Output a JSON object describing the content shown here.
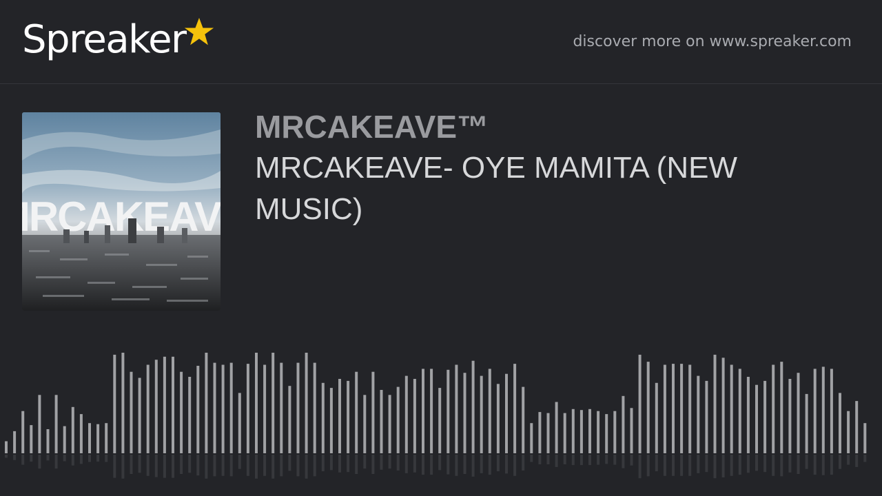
{
  "header": {
    "logo_text": "Spreaker",
    "discover_link": "discover more on www.spreaker.com"
  },
  "episode": {
    "cover_overlay_text": "MRCAKEAVE",
    "channel_name": "MRCAKEAVE™",
    "title": "MRCAKEAVE- OYE MAMITA (NEW MUSIC)"
  },
  "waveform": {
    "bar_color": "#a1a2a5",
    "levels": [
      0.12,
      0.22,
      0.42,
      0.28,
      0.58,
      0.24,
      0.58,
      0.27,
      0.46,
      0.39,
      0.3,
      0.29,
      0.3,
      0.98,
      1.0,
      0.81,
      0.75,
      0.88,
      0.93,
      0.96,
      0.96,
      0.81,
      0.76,
      0.87,
      1.0,
      0.9,
      0.88,
      0.9,
      0.6,
      0.89,
      1.0,
      0.88,
      1.0,
      0.9,
      0.67,
      0.9,
      1.0,
      0.9,
      0.7,
      0.65,
      0.74,
      0.72,
      0.81,
      0.58,
      0.81,
      0.63,
      0.58,
      0.66,
      0.77,
      0.74,
      0.84,
      0.84,
      0.65,
      0.83,
      0.88,
      0.8,
      0.92,
      0.77,
      0.84,
      0.69,
      0.79,
      0.89,
      0.66,
      0.3,
      0.41,
      0.4,
      0.51,
      0.4,
      0.44,
      0.43,
      0.44,
      0.42,
      0.39,
      0.42,
      0.57,
      0.45,
      0.98,
      0.91,
      0.7,
      0.88,
      0.89,
      0.89,
      0.88,
      0.77,
      0.72,
      0.98,
      0.95,
      0.88,
      0.84,
      0.76,
      0.68,
      0.72,
      0.88,
      0.91,
      0.74,
      0.8,
      0.59,
      0.84,
      0.86,
      0.84,
      0.6,
      0.42,
      0.52,
      0.3
    ],
    "reflection_levels": [
      0.08,
      0.14,
      0.26,
      0.18,
      0.36,
      0.15,
      0.36,
      0.17,
      0.28,
      0.24,
      0.19,
      0.18,
      0.19,
      0.6,
      0.62,
      0.5,
      0.47,
      0.55,
      0.58,
      0.6,
      0.6,
      0.5,
      0.47,
      0.54,
      0.62,
      0.56,
      0.55,
      0.56,
      0.37,
      0.55,
      0.62,
      0.55,
      0.62,
      0.56,
      0.42,
      0.56,
      0.62,
      0.56,
      0.43,
      0.4,
      0.46,
      0.45,
      0.5,
      0.36,
      0.5,
      0.39,
      0.36,
      0.41,
      0.48,
      0.46,
      0.52,
      0.52,
      0.4,
      0.51,
      0.55,
      0.5,
      0.57,
      0.48,
      0.52,
      0.43,
      0.49,
      0.55,
      0.41,
      0.19,
      0.25,
      0.25,
      0.32,
      0.25,
      0.27,
      0.27,
      0.27,
      0.26,
      0.24,
      0.26,
      0.35,
      0.28,
      0.61,
      0.56,
      0.43,
      0.55,
      0.55,
      0.55,
      0.55,
      0.48,
      0.45,
      0.61,
      0.59,
      0.55,
      0.52,
      0.47,
      0.42,
      0.45,
      0.55,
      0.56,
      0.46,
      0.5,
      0.37,
      0.52,
      0.53,
      0.52,
      0.37,
      0.26,
      0.32,
      0.19
    ]
  },
  "colors": {
    "background": "#232428",
    "accent_star": "#f5c20b",
    "channel_name": "#9a9b9f",
    "title": "#d7d8da"
  },
  "icons": {
    "logo_star": "star-icon"
  }
}
